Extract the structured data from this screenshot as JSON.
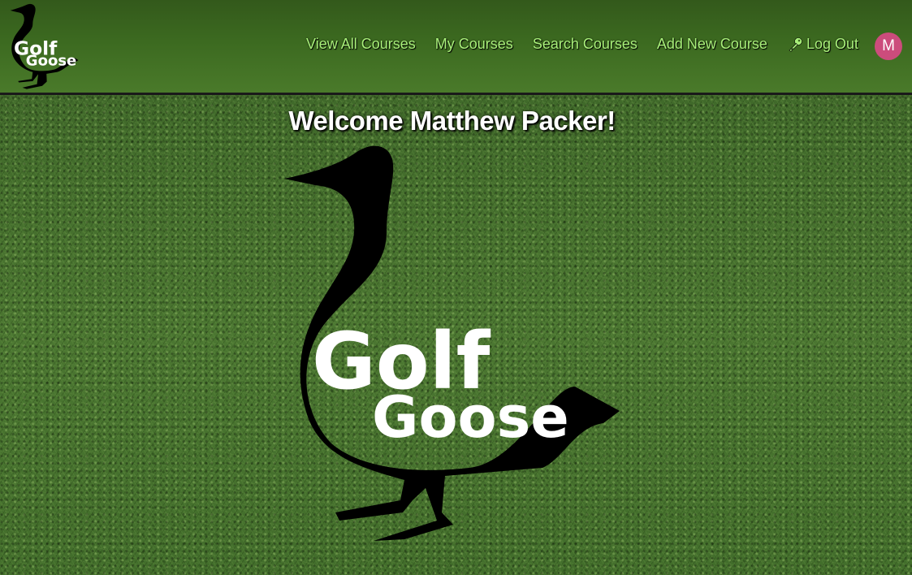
{
  "navbar": {
    "logo_line1": "Golf",
    "logo_line2": "Goose",
    "links": [
      {
        "label": "View All Courses"
      },
      {
        "label": "My Courses"
      },
      {
        "label": "Search Courses"
      },
      {
        "label": "Add New Course"
      },
      {
        "label": "Log Out",
        "icon": "key-icon"
      }
    ],
    "avatar_initial": "M",
    "link_color": "#a9f07a",
    "avatar_color": "#cc4c7c"
  },
  "main": {
    "welcome": "Welcome Matthew Packer!",
    "logo_line1": "Golf",
    "logo_line2": "Goose"
  }
}
